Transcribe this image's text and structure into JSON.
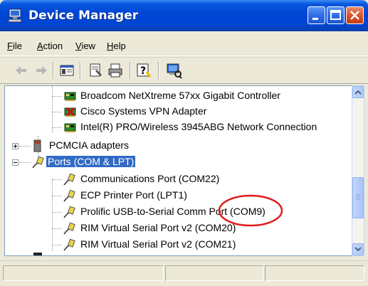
{
  "window": {
    "title": "Device Manager"
  },
  "menu": [
    {
      "label": "File",
      "underline": "F",
      "rest": "ile"
    },
    {
      "label": "Action",
      "underline": "A",
      "rest": "ction"
    },
    {
      "label": "View",
      "underline": "V",
      "rest": "iew"
    },
    {
      "label": "Help",
      "underline": "H",
      "rest": "elp"
    }
  ],
  "toolbar_icons": [
    "back-arrow-icon",
    "forward-arrow-icon",
    "show-hide-console-tree-icon",
    "properties-icon",
    "print-icon",
    "help-icon",
    "scan-hardware-icon"
  ],
  "tree": {
    "network_items": [
      {
        "label": "Broadcom NetXtreme 57xx Gigabit Controller",
        "icon": "network-adapter-icon"
      },
      {
        "label": "Cisco Systems VPN Adapter",
        "icon": "network-adapter-disabled-icon"
      },
      {
        "label": "Intel(R) PRO/Wireless 3945ABG Network Connection",
        "icon": "network-adapter-icon"
      }
    ],
    "pcmcia": {
      "label": "PCMCIA adapters",
      "expander": "+"
    },
    "ports": {
      "label": "Ports (COM & LPT)",
      "expander": "−",
      "selected": true
    },
    "port_items": [
      {
        "label": "Communications Port (COM22)"
      },
      {
        "label": "ECP Printer Port (LPT1)"
      },
      {
        "label": "Prolific USB-to-Serial Comm Port (COM9)"
      },
      {
        "label": "RIM Virtual Serial Port v2 (COM20)"
      },
      {
        "label": "RIM Virtual Serial Port v2 (COM21)"
      }
    ]
  },
  "colors": {
    "title_blue": "#0046D5",
    "selection": "#316AC5",
    "annotation": "#E21B1B"
  }
}
